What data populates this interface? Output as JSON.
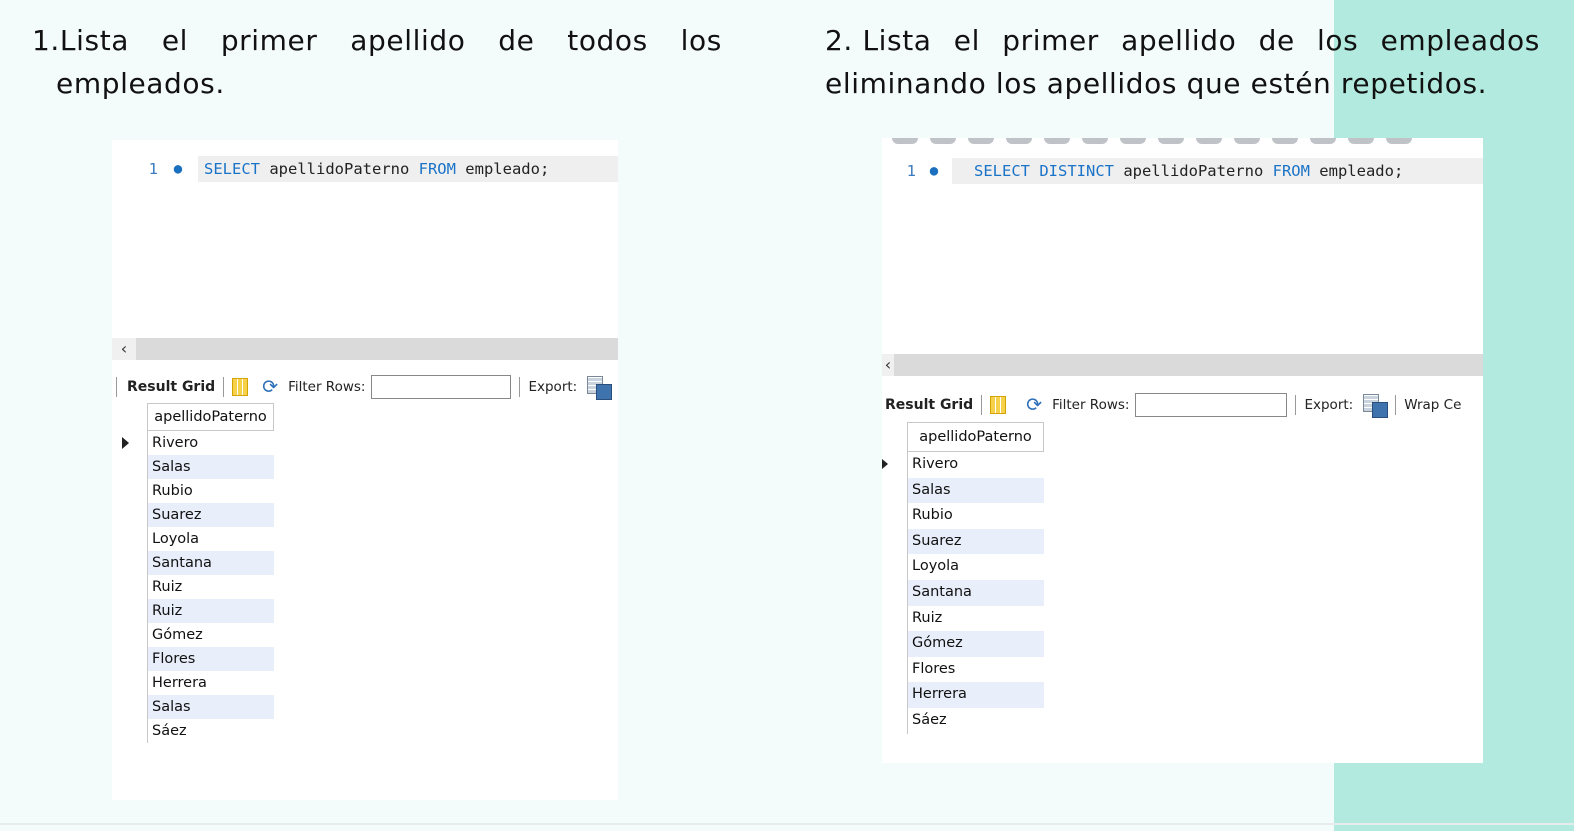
{
  "left": {
    "heading": {
      "number": "1.",
      "words": [
        "Lista",
        "el",
        "primer",
        "apellido",
        "de",
        "todos",
        "los"
      ],
      "line2": "empleados."
    },
    "query": {
      "line_number": "1",
      "dot": "●",
      "kw1": "SELECT",
      "col": " apellidoPaterno ",
      "kw2": "FROM",
      "rest": " empleado;"
    },
    "toolbar": {
      "result_grid": "Result Grid",
      "filter_rows": "Filter Rows:",
      "export": "Export:"
    },
    "grid": {
      "column": "apellidoPaterno",
      "rows": [
        "Rivero",
        "Salas",
        "Rubio",
        "Suarez",
        "Loyola",
        "Santana",
        "Ruiz",
        "Ruiz",
        "Gómez",
        "Flores",
        "Herrera",
        "Salas",
        "Sáez"
      ]
    }
  },
  "right": {
    "heading": {
      "number": "2.",
      "words": [
        "Lista",
        "el",
        "primer",
        "apellido",
        "de",
        "los",
        "empleados"
      ],
      "line2": "eliminando los apellidos que estén repetidos."
    },
    "query": {
      "line_number": "1",
      "dot": "●",
      "kw1": "SELECT DISTINCT",
      "col": " apellidoPaterno ",
      "kw2": "FROM",
      "rest": " empleado;"
    },
    "toolbar": {
      "result_grid": "Result Grid",
      "filter_rows": "Filter Rows:",
      "export": "Export:",
      "wrap": "Wrap Ce"
    },
    "grid": {
      "column": "apellidoPaterno",
      "rows": [
        "Rivero",
        "Salas",
        "Rubio",
        "Suarez",
        "Loyola",
        "Santana",
        "Ruiz",
        "Gómez",
        "Flores",
        "Herrera",
        "Sáez"
      ]
    }
  },
  "colors": {
    "accent": "#b2eadf",
    "background": "#f4fcfb",
    "keyword": "#1a73c7",
    "alt_row": "#e8eefa"
  }
}
